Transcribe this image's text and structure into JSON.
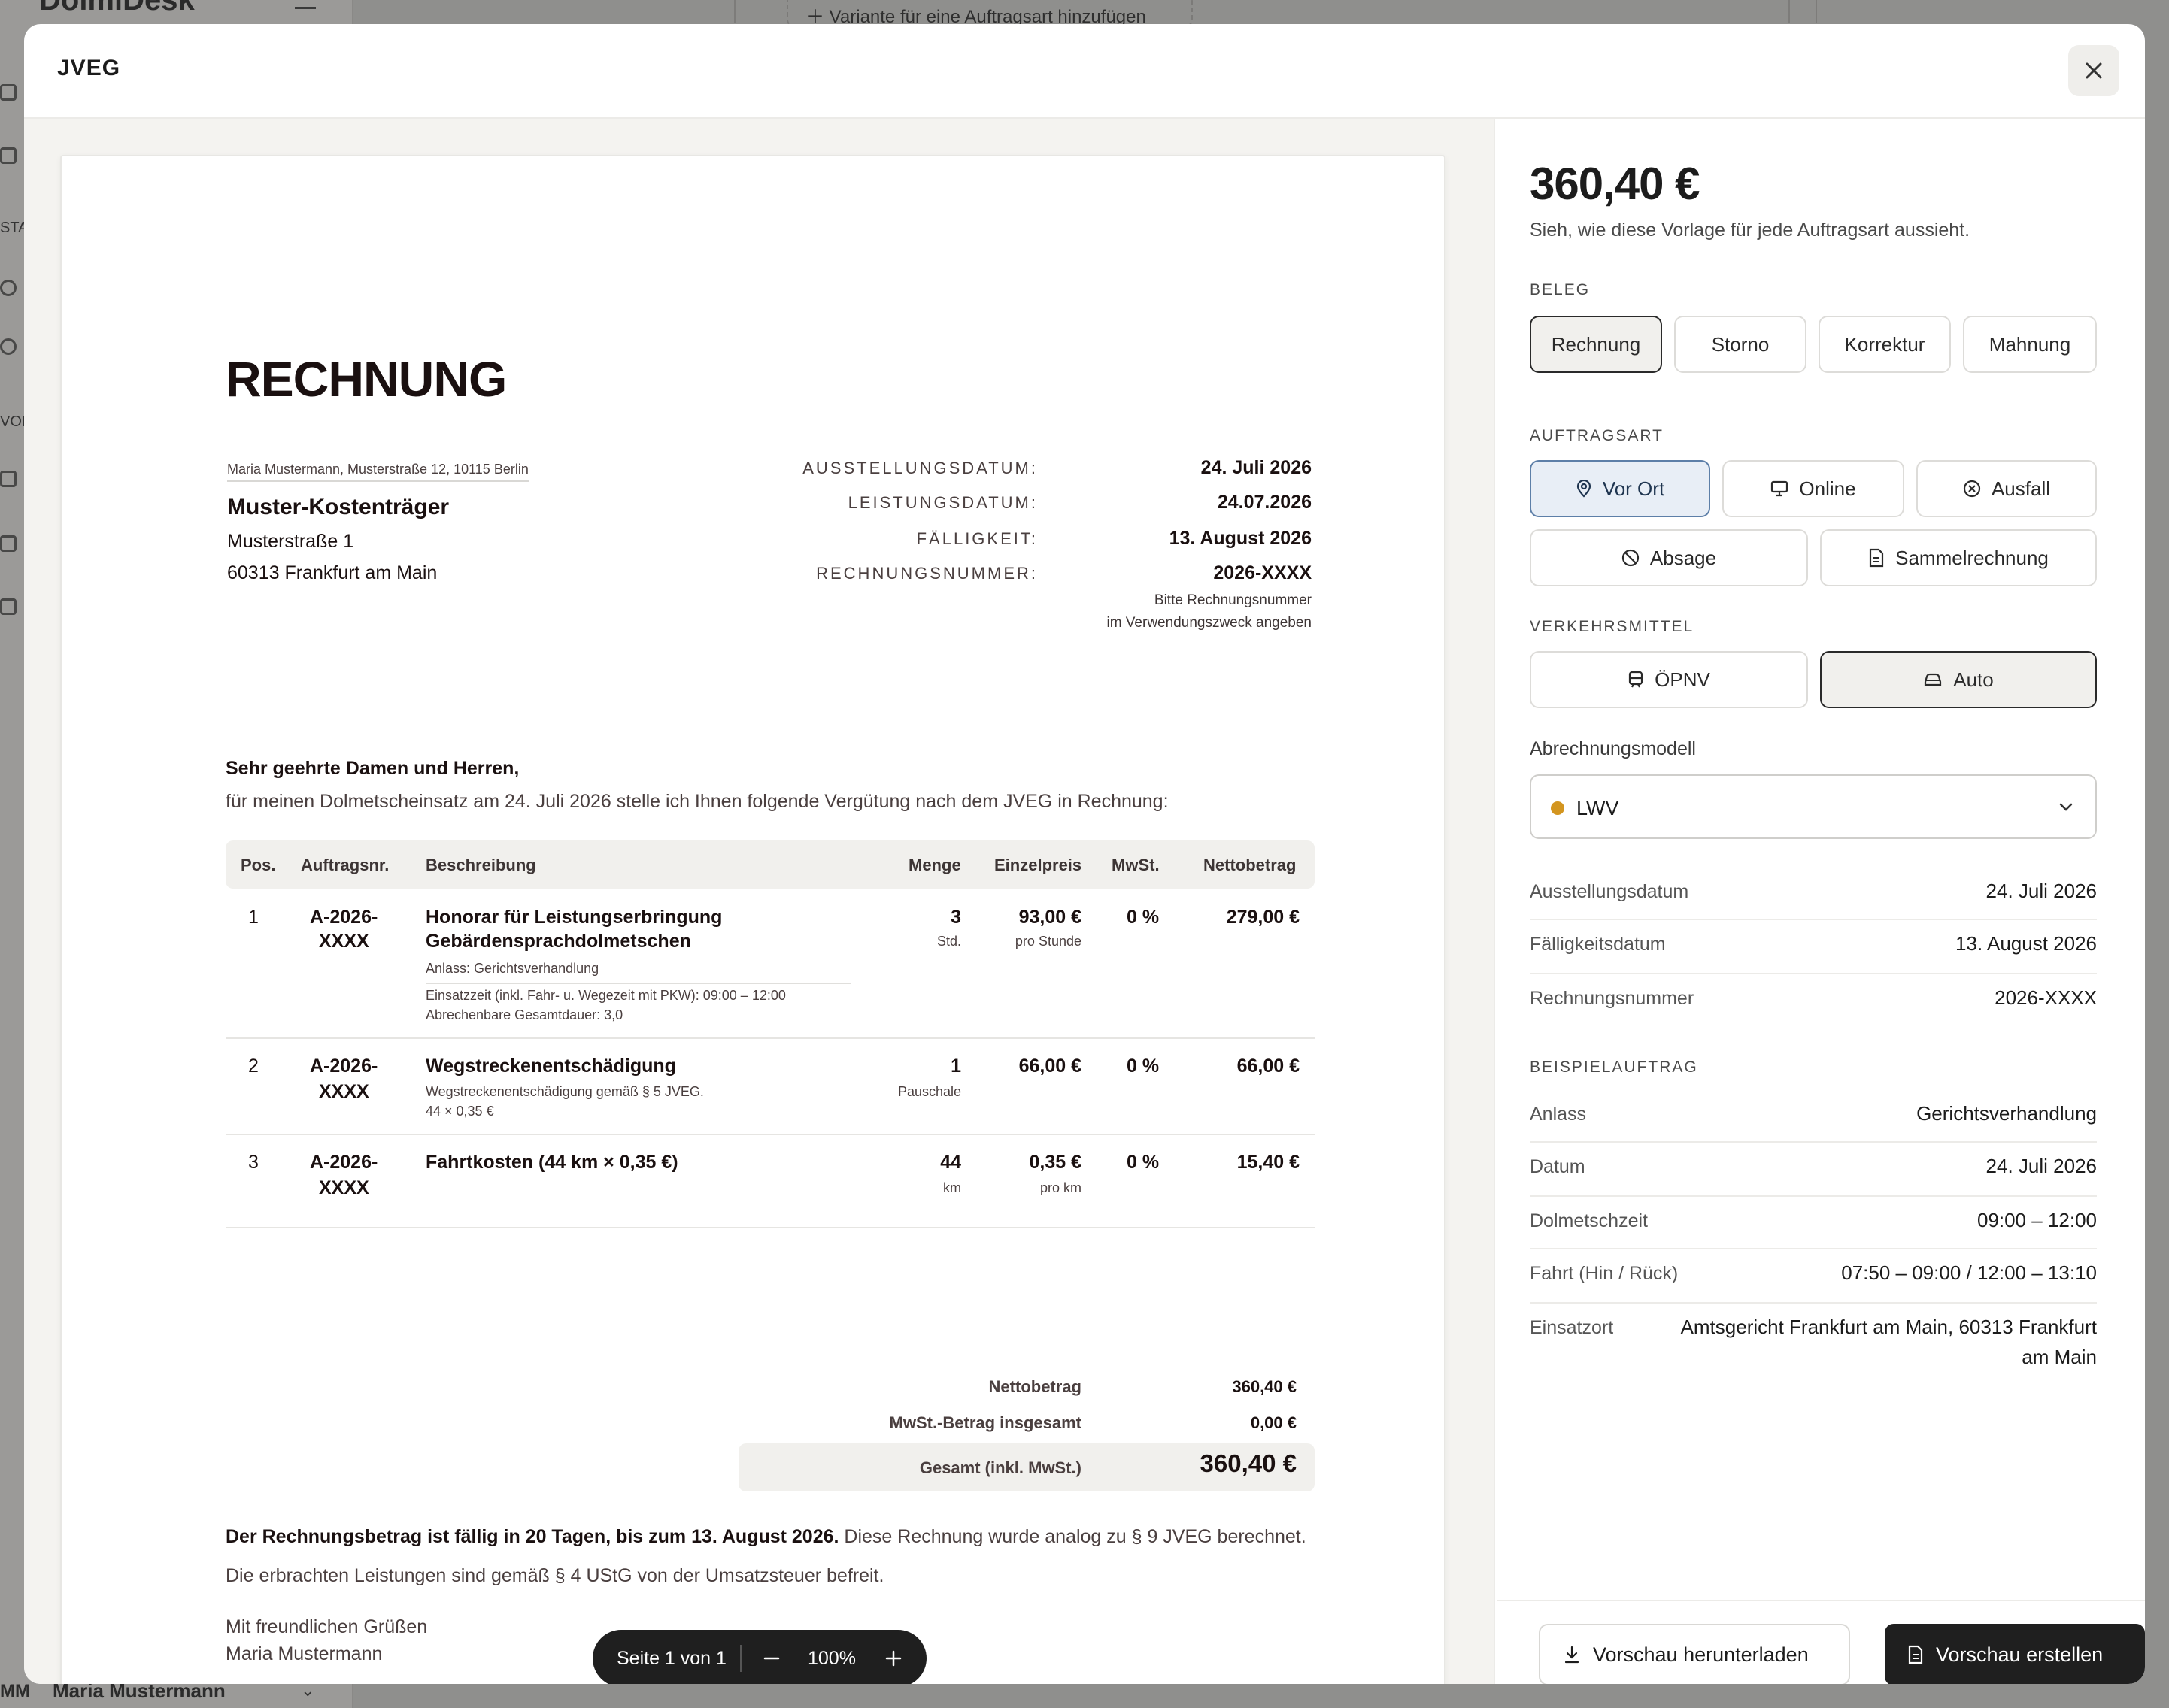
{
  "background": {
    "brand": "DolmiDesk",
    "variant_button": "Variante für eine Auftragsart hinzufügen",
    "rail_texts": [
      "STA",
      "VOR"
    ],
    "user": {
      "initials": "MM",
      "name": "Maria Mustermann"
    }
  },
  "modal": {
    "title": "JVEG",
    "close_icon": "close-icon"
  },
  "invoice": {
    "title": "RECHNUNG",
    "sender_line": "Maria Mustermann, Musterstraße 12, 10115 Berlin",
    "recipient": {
      "name": "Muster-Kostenträger",
      "street": "Musterstraße 1",
      "city": "60313 Frankfurt am Main"
    },
    "meta": [
      {
        "label": "AUSSTELLUNGSDATUM:",
        "value": "24. Juli 2026"
      },
      {
        "label": "LEISTUNGSDATUM:",
        "value": "24.07.2026"
      },
      {
        "label": "FÄLLIGKEIT:",
        "value": "13. August 2026"
      },
      {
        "label": "RECHNUNGSNUMMER:",
        "value": "2026-XXXX"
      }
    ],
    "meta_note_1": "Bitte Rechnungsnummer",
    "meta_note_2": "im Verwendungszweck angeben",
    "salutation": "Sehr geehrte Damen und Herren,",
    "intro": "für meinen Dolmetscheinsatz am 24. Juli 2026 stelle ich Ihnen folgende Vergütung nach dem JVEG in Rechnung:",
    "columns": {
      "pos": "Pos.",
      "order": "Auftragsnr.",
      "desc": "Beschreibung",
      "qty": "Menge",
      "unit_price": "Einzelpreis",
      "vat": "MwSt.",
      "net": "Nettobetrag"
    },
    "rows": [
      {
        "pos": "1",
        "order_1": "A-2026-",
        "order_2": "XXXX",
        "desc_1": "Honorar für Leistungserbringung",
        "desc_2": "Gebärdensprachdolmetschen",
        "note_1": "Anlass: Gerichtsverhandlung",
        "note_2": "Einsatzzeit (inkl. Fahr- u. Wegezeit mit PKW): 09:00 – 12:00",
        "note_3": "Abrechenbare Gesamtdauer: 3,0",
        "qty": "3",
        "qty_unit": "Std.",
        "price": "93,00 €",
        "price_unit": "pro Stunde",
        "vat": "0 %",
        "net": "279,00 €"
      },
      {
        "pos": "2",
        "order_1": "A-2026-",
        "order_2": "XXXX",
        "desc_1": "Wegstreckenentschädigung",
        "note_1": "Wegstreckenentschädigung gemäß § 5 JVEG.",
        "note_2": "44 × 0,35 €",
        "qty": "1",
        "qty_unit": "Pauschale",
        "price": "66,00 €",
        "vat": "0 %",
        "net": "66,00 €"
      },
      {
        "pos": "3",
        "order_1": "A-2026-",
        "order_2": "XXXX",
        "desc_1": "Fahrtkosten (44 km × 0,35 €)",
        "qty": "44",
        "qty_unit": "km",
        "price": "0,35 €",
        "price_unit": "pro km",
        "vat": "0 %",
        "net": "15,40 €"
      }
    ],
    "totals": {
      "net_label": "Nettobetrag",
      "net_value": "360,40 €",
      "vat_label": "MwSt.-Betrag insgesamt",
      "vat_value": "0,00 €",
      "gross_label": "Gesamt (inkl. MwSt.)",
      "gross_value": "360,40 €"
    },
    "due_bold": "Der Rechnungsbetrag ist fällig in 20 Tagen, bis zum 13. August 2026.",
    "due_rest": " Diese Rechnung wurde analog zu § 9 JVEG berechnet.",
    "tax_note": "Die erbrachten Leistungen sind gemäß § 4 UStG von der Umsatzsteuer befreit.",
    "closing": "Mit freundlichen Grüßen",
    "signature": "Maria Mustermann"
  },
  "zoom": {
    "page": "Seite 1 von 1",
    "level": "100%"
  },
  "side": {
    "amount": "360,40 €",
    "subtitle": "Sieh, wie diese Vorlage für jede Auftragsart aussieht.",
    "beleg_label": "BELEG",
    "beleg": [
      "Rechnung",
      "Storno",
      "Korrektur",
      "Mahnung"
    ],
    "beleg_selected": "Rechnung",
    "auftragsart_label": "AUFTRAGSART",
    "auftragsart": [
      "Vor Ort",
      "Online",
      "Ausfall",
      "Absage",
      "Sammelrechnung"
    ],
    "auftragsart_selected": "Vor Ort",
    "verkehr_label": "VERKEHRSMITTEL",
    "verkehr": [
      "ÖPNV",
      "Auto"
    ],
    "verkehr_selected": "Auto",
    "modell_label": "Abrechnungsmodell",
    "modell_value": "LWV",
    "modell_color": "#d3951f",
    "details": [
      {
        "key": "Ausstellungsdatum",
        "value": "24. Juli 2026"
      },
      {
        "key": "Fälligkeitsdatum",
        "value": "13. August 2026"
      },
      {
        "key": "Rechnungsnummer",
        "value": "2026-XXXX"
      }
    ],
    "beispiel_label": "BEISPIELAUFTRAG",
    "beispiel": [
      {
        "key": "Anlass",
        "value": "Gerichtsverhandlung"
      },
      {
        "key": "Datum",
        "value": "24. Juli 2026"
      },
      {
        "key": "Dolmetschzeit",
        "value": "09:00 – 12:00"
      },
      {
        "key": "Fahrt (Hin / Rück)",
        "value": "07:50 – 09:00 / 12:00 – 13:10"
      }
    ],
    "einsatzort_key": "Einsatzort",
    "einsatzort_1": "Amtsgericht Frankfurt am Main, 60313 Frankfurt",
    "einsatzort_2": "am Main",
    "download_label": "Vorschau herunterladen",
    "create_label": "Vorschau erstellen"
  }
}
